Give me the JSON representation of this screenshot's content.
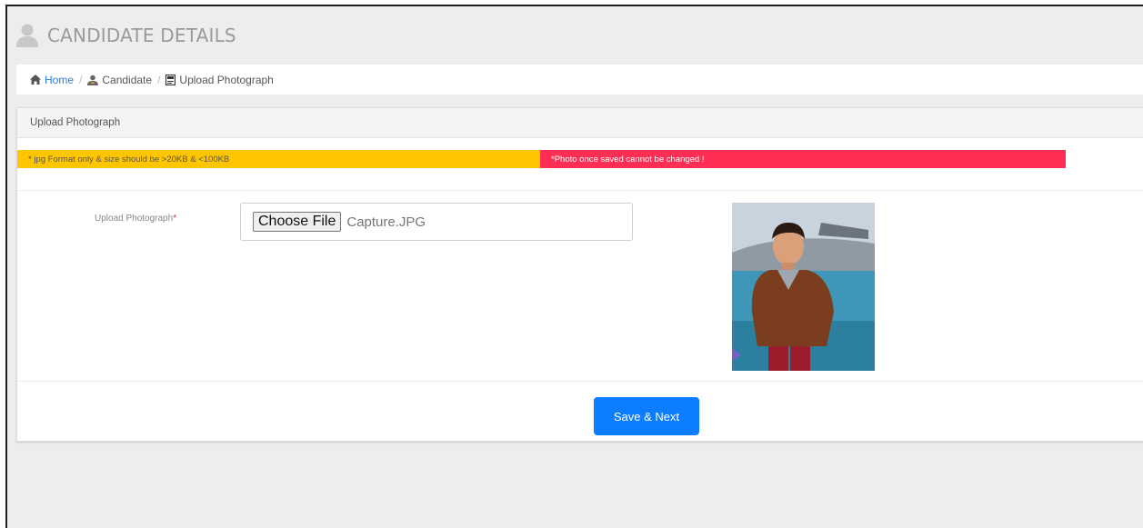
{
  "header": {
    "title": "CANDIDATE DETAILS",
    "icon": "user-icon"
  },
  "breadcrumb": {
    "items": [
      {
        "label": "Home",
        "icon": "home-icon"
      },
      {
        "label": "Candidate",
        "icon": "user-badge-icon"
      },
      {
        "label": "Upload Photograph",
        "icon": "document-icon"
      }
    ],
    "separator": "/"
  },
  "panel": {
    "title": "Upload Photograph",
    "notice_format": "* jpg Format only & size should be >20KB & <100KB",
    "notice_warning": "*Photo once saved cannot be changed !",
    "field_label": "Upload Photograph",
    "required_mark": "*",
    "file_button_label": "Choose File",
    "file_name": "Capture.JPG",
    "save_label": "Save & Next"
  },
  "colors": {
    "notice_yellow": "#ffc600",
    "notice_red": "#ff2e55",
    "primary": "#0d7dff",
    "link": "#2c7be5"
  }
}
